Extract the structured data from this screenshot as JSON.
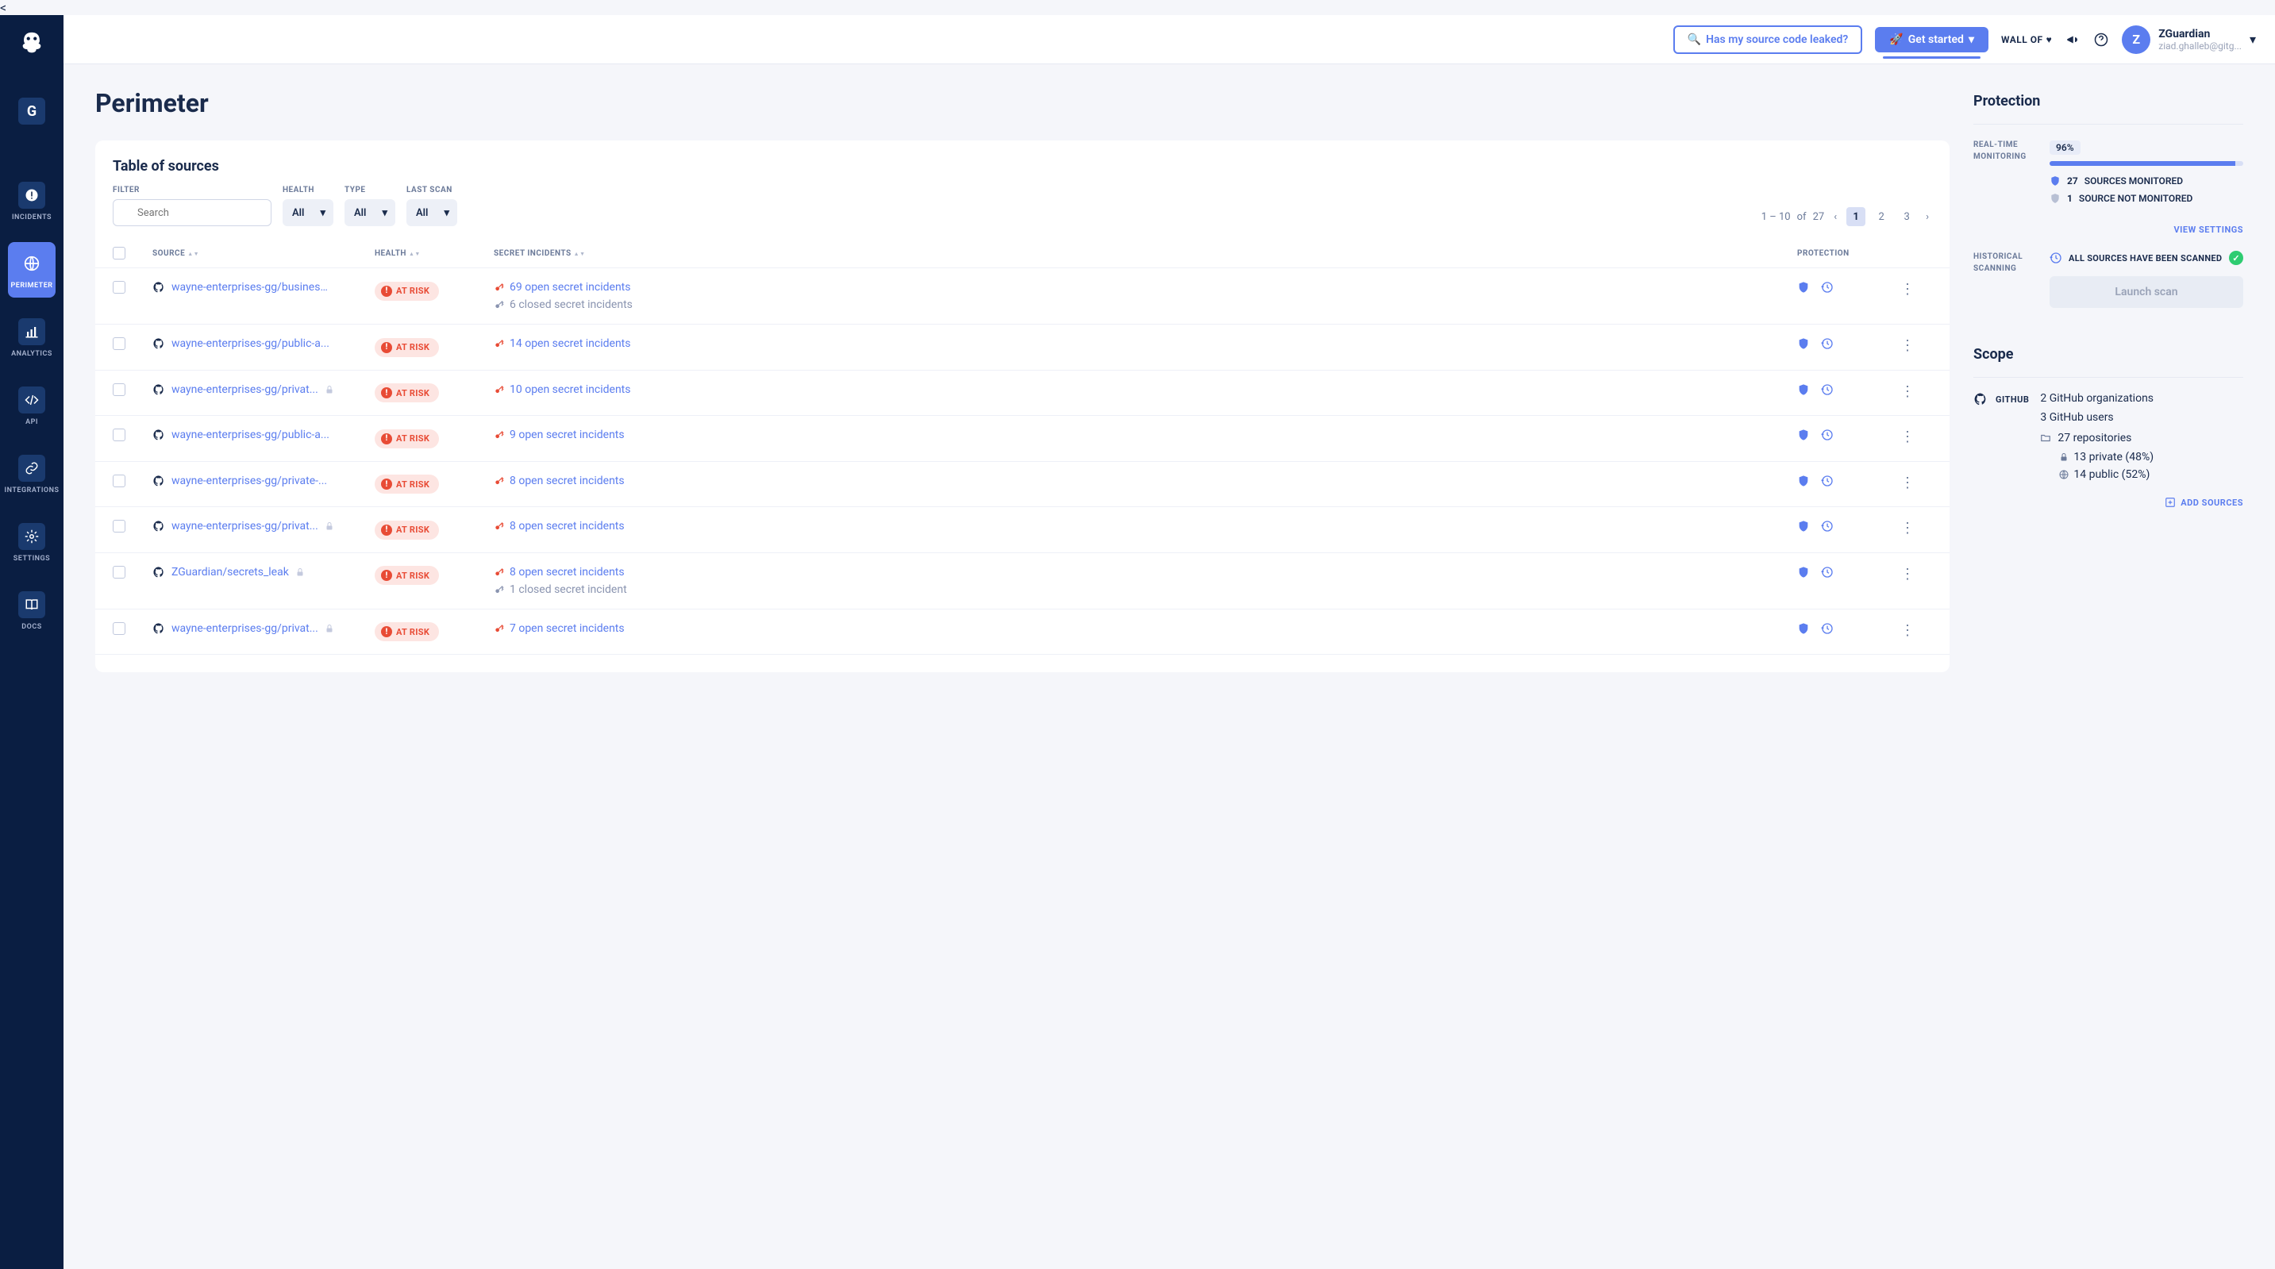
{
  "sidebar": {
    "items": [
      {
        "label": "",
        "key": "g"
      },
      {
        "label": "INCIDENTS"
      },
      {
        "label": "PERIMETER"
      },
      {
        "label": "ANALYTICS"
      },
      {
        "label": "API"
      },
      {
        "label": "INTEGRATIONS"
      },
      {
        "label": "SETTINGS"
      },
      {
        "label": "DOCS"
      }
    ]
  },
  "header": {
    "leaked_btn": "Has my source code leaked?",
    "get_started": "Get started",
    "wall_of": "WALL OF",
    "user_initial": "Z",
    "user_name": "ZGuardian",
    "user_email": "ziad.ghalleb@gitg..."
  },
  "page": {
    "title": "Perimeter",
    "card_title": "Table of sources"
  },
  "filters": {
    "filter_label": "FILTER",
    "search_placeholder": "Search",
    "health_label": "HEALTH",
    "health_value": "All",
    "type_label": "TYPE",
    "type_value": "All",
    "lastscan_label": "LAST SCAN",
    "lastscan_value": "All"
  },
  "pagination": {
    "range": "1 – 10",
    "of": "of",
    "total": "27",
    "pages": [
      "1",
      "2",
      "3"
    ]
  },
  "columns": {
    "source": "SOURCE",
    "health": "HEALTH",
    "incidents": "SECRET INCIDENTS",
    "protection": "PROTECTION"
  },
  "health_badge": "AT RISK",
  "rows": [
    {
      "source": "wayne-enterprises-gg/business...",
      "lock": false,
      "open": "69 open secret incidents",
      "closed": "6 closed secret incidents"
    },
    {
      "source": "wayne-enterprises-gg/public-a...",
      "lock": false,
      "open": "14 open secret incidents"
    },
    {
      "source": "wayne-enterprises-gg/privat...",
      "lock": true,
      "open": "10 open secret incidents"
    },
    {
      "source": "wayne-enterprises-gg/public-a...",
      "lock": false,
      "open": "9 open secret incidents"
    },
    {
      "source": "wayne-enterprises-gg/private-...",
      "lock": false,
      "open": "8 open secret incidents"
    },
    {
      "source": "wayne-enterprises-gg/privat...",
      "lock": true,
      "open": "8 open secret incidents"
    },
    {
      "source": "ZGuardian/secrets_leak",
      "lock": true,
      "open": "8 open secret incidents",
      "closed": "1 closed secret incident"
    },
    {
      "source": "wayne-enterprises-gg/privat...",
      "lock": true,
      "open": "7 open secret incidents"
    }
  ],
  "protection": {
    "title": "Protection",
    "realtime_label": "REAL-TIME MONITORING",
    "pct": "96%",
    "monitored_num": "27",
    "monitored_text": "SOURCES MONITORED",
    "not_monitored_num": "1",
    "not_monitored_text": "SOURCE NOT MONITORED",
    "view_settings": "VIEW SETTINGS",
    "historical_label": "HISTORICAL SCANNING",
    "all_scanned": "ALL SOURCES HAVE BEEN SCANNED",
    "launch": "Launch scan"
  },
  "scope": {
    "title": "Scope",
    "github": "GITHUB",
    "orgs": "2 GitHub organizations",
    "users": "3 GitHub users",
    "repos": "27 repositories",
    "private": "13 private (48%)",
    "public": "14 public (52%)",
    "add": "ADD SOURCES"
  }
}
